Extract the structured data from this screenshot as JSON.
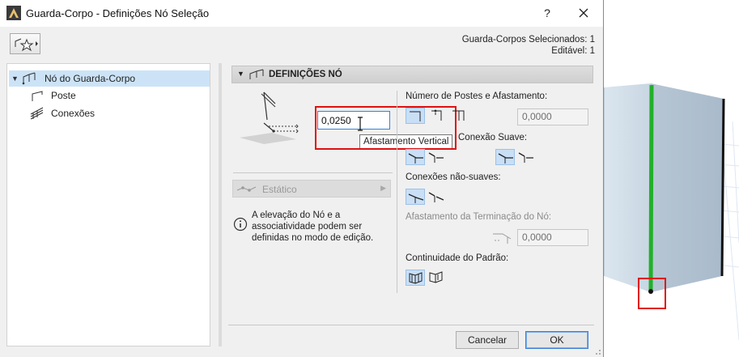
{
  "window": {
    "title": "Guarda-Corpo - Definições Nó Seleção",
    "help_label": "?"
  },
  "header": {
    "selected_info": "Guarda-Corpos Selecionados: 1",
    "editable_info": "Editável: 1"
  },
  "tree": {
    "items": [
      {
        "label": "Nó do Guarda-Corpo",
        "icon": "railing-node-icon",
        "selected": true
      },
      {
        "label": "Poste",
        "icon": "post-icon"
      },
      {
        "label": "Conexões",
        "icon": "connections-icon"
      }
    ]
  },
  "section": {
    "title": "DEFINIÇÕES NÓ"
  },
  "vertical_offset": {
    "value": "0,0250",
    "tooltip": "Afastamento Vertical"
  },
  "static_dropdown": {
    "label": "Estático"
  },
  "info": {
    "text": "A elevação do Nó e a associatividade podem ser definidas no modo de edição."
  },
  "right_panel": {
    "posts_label": "Número de Postes e Afastamento:",
    "posts_value": "0,0000",
    "smooth_label": "Conexão Suave:",
    "nonsmooth_label": "Conexões não-suaves:",
    "end_offset_label": "Afastamento da Terminação do Nó:",
    "end_offset_value": "0,0000",
    "pattern_label": "Continuidade do Padrão:"
  },
  "buttons": {
    "cancel": "Cancelar",
    "ok": "OK"
  },
  "colors": {
    "accent": "#3b7fd6",
    "highlight": "#e01010",
    "selection": "#cce3f7",
    "railing_post": "#22b02a"
  }
}
